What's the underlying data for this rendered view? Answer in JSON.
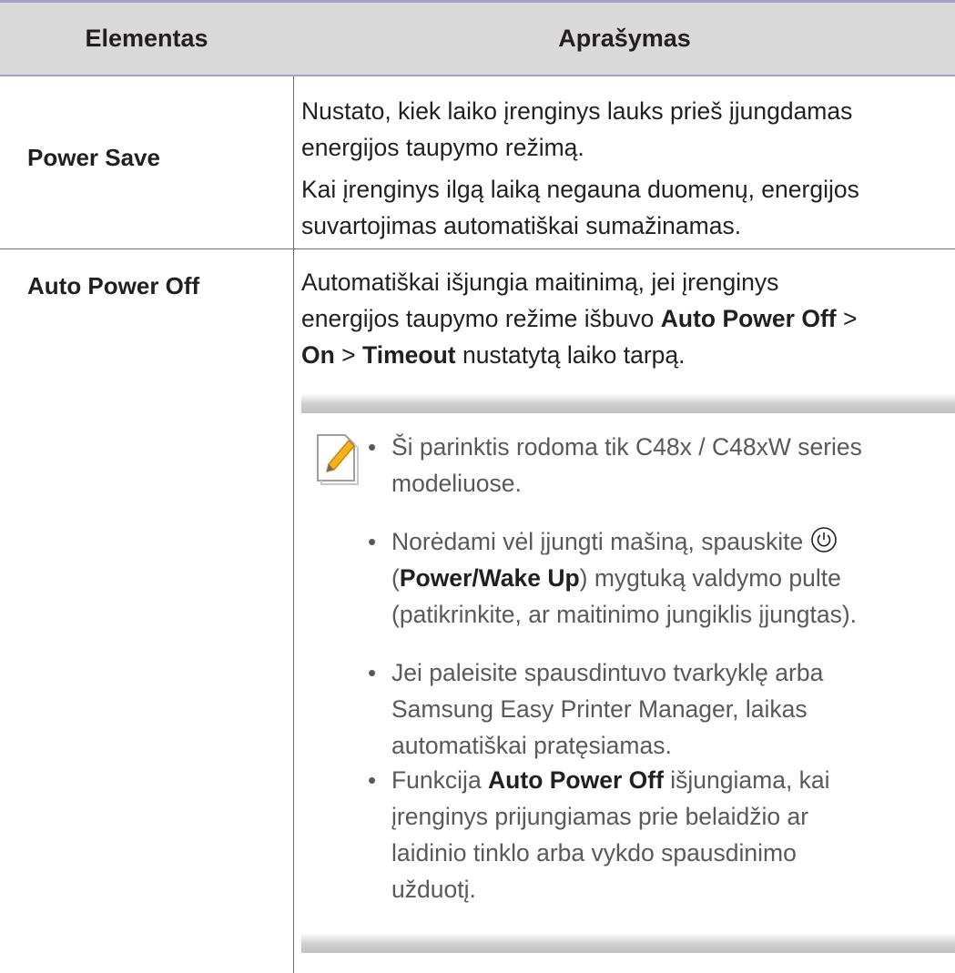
{
  "table": {
    "headers": {
      "item": "Elementas",
      "description": "Aprašymas"
    },
    "rows": [
      {
        "item": "Power Save",
        "paragraphs": [
          {
            "line1": "Nustato, kiek laiko įrenginys lauks prieš įjungdamas",
            "line2": "energijos taupymo režimą."
          },
          {
            "line1": "Kai įrenginys ilgą laiką negauna duomenų, energijos",
            "line2": "suvartojimas automatiškai sumažinamas."
          }
        ]
      },
      {
        "item": "Auto Power Off",
        "line1": "Automatiškai išjungia maitinimą, jei įrenginys",
        "line2_pre": "energijos taupymo režime išbuvo ",
        "line2_bold": "Auto Power Off",
        "line2_post": " >",
        "line3_bold1": "On",
        "line3_mid": " > ",
        "line3_bold2": "Timeout",
        "line3_post": " nustatytą laiko tarpą.",
        "notes": [
          {
            "line1": "Ši parinktis rodoma tik C48x / C48xW series",
            "line2": "modeliuose."
          },
          {
            "line1": "Norėdami vėl įjungti mašiną, spauskite ",
            "icon": "power-icon",
            "line2_pre": "(",
            "line2_bold": "Power/Wake Up",
            "line2_post": ") mygtuką valdymo pulte",
            "line3": "(patikrinkite, ar maitinimo jungiklis įjungtas)."
          },
          {
            "line1": "Jei paleisite spausdintuvo tvarkyklę arba",
            "line2": "Samsung Easy Printer Manager, laikas",
            "line3": "automatiškai pratęsiamas."
          },
          {
            "line1_pre": "Funkcija ",
            "line1_bold": "Auto Power Off",
            "line1_post": " išjungiama, kai",
            "line2": "įrenginys prijungiamas prie belaidžio ar",
            "line3": "laidinio tinklo arba vykdo spausdinimo",
            "line4": "užduotį."
          }
        ]
      }
    ]
  },
  "bullet_char": "•",
  "icons": {
    "note": "note-pencil-icon",
    "power": "power-icon"
  },
  "colors": {
    "header_bg": "#d9d9d9",
    "rule": "#a3a1c9",
    "text": "#231f20",
    "note_text": "#58595b",
    "note_accent": "#f5b21b"
  }
}
